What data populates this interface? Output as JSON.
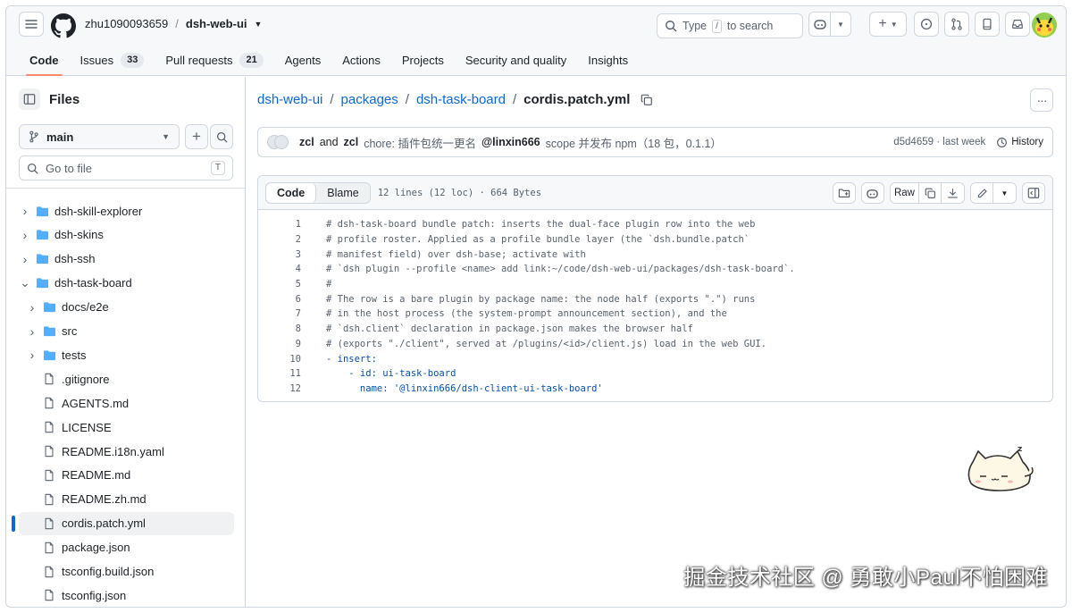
{
  "header": {
    "owner": "zhu1090093659",
    "repo": "dsh-web-ui",
    "search_prefix": "Type",
    "search_key": "/",
    "search_suffix": "to search"
  },
  "nav": {
    "tabs": [
      {
        "label": "Code",
        "count": ""
      },
      {
        "label": "Issues",
        "count": "33"
      },
      {
        "label": "Pull requests",
        "count": "21"
      },
      {
        "label": "Agents",
        "count": ""
      },
      {
        "label": "Actions",
        "count": ""
      },
      {
        "label": "Projects",
        "count": ""
      },
      {
        "label": "Security and quality",
        "count": ""
      },
      {
        "label": "Insights",
        "count": ""
      }
    ]
  },
  "sidebar": {
    "title": "Files",
    "branch": "main",
    "goto_placeholder": "Go to file",
    "goto_key": "T",
    "items": [
      {
        "label": "dsh-skill-explorer",
        "type": "folder",
        "expanded": false,
        "depth": 0
      },
      {
        "label": "dsh-skins",
        "type": "folder",
        "expanded": false,
        "depth": 0
      },
      {
        "label": "dsh-ssh",
        "type": "folder",
        "expanded": false,
        "depth": 0
      },
      {
        "label": "dsh-task-board",
        "type": "folder",
        "expanded": true,
        "depth": 0
      },
      {
        "label": "docs/e2e",
        "type": "folder",
        "expanded": false,
        "depth": 1
      },
      {
        "label": "src",
        "type": "folder",
        "expanded": false,
        "depth": 1
      },
      {
        "label": "tests",
        "type": "folder",
        "expanded": false,
        "depth": 1
      },
      {
        "label": ".gitignore",
        "type": "file",
        "depth": 1
      },
      {
        "label": "AGENTS.md",
        "type": "file",
        "depth": 1
      },
      {
        "label": "LICENSE",
        "type": "file",
        "depth": 1
      },
      {
        "label": "README.i18n.yaml",
        "type": "file",
        "depth": 1
      },
      {
        "label": "README.md",
        "type": "file",
        "depth": 1
      },
      {
        "label": "README.zh.md",
        "type": "file",
        "depth": 1
      },
      {
        "label": "cordis.patch.yml",
        "type": "file",
        "depth": 1,
        "selected": true
      },
      {
        "label": "package.json",
        "type": "file",
        "depth": 1
      },
      {
        "label": "tsconfig.build.json",
        "type": "file",
        "depth": 1
      },
      {
        "label": "tsconfig.json",
        "type": "file",
        "depth": 1
      }
    ]
  },
  "breadcrumb": {
    "parts": [
      "dsh-web-ui",
      "packages",
      "dsh-task-board"
    ],
    "current": "cordis.patch.yml"
  },
  "commit": {
    "author1": "zcl",
    "and": "and",
    "author2": "zcl",
    "message_prefix": "chore: 插件包统一更名",
    "handle": "@linxin666",
    "message_suffix": "scope 并发布 npm（18 包，0.1.1）",
    "sha": "d5d4659",
    "dot": "·",
    "when": "last week",
    "history_label": "History"
  },
  "file": {
    "view_code": "Code",
    "view_blame": "Blame",
    "info": "12 lines (12 loc) · 664 Bytes",
    "raw_label": "Raw",
    "lines": [
      "# dsh-task-board bundle patch: inserts the dual-face plugin row into the web",
      "# profile roster. Applied as a profile bundle layer (the `dsh.bundle.patch`",
      "# manifest field) over dsh-base; activate with",
      "# `dsh plugin --profile <name> add link:~/code/dsh-web-ui/packages/dsh-task-board`.",
      "#",
      "# The row is a bare plugin by package name: the node half (exports \".\") runs",
      "# in the host process (the system-prompt announcement section), and the",
      "# `dsh.client` declaration in package.json makes the browser half",
      "# (exports \"./client\", served at /plugins/<id>/client.js) load in the web GUI.",
      "- insert:",
      "    - id: ui-task-board",
      "      name: '@linxin666/dsh-client-ui-task-board'"
    ]
  },
  "watermark": "掘金技术社区 @ 勇敢小Paul不怕困难",
  "colors": {
    "accent": "#0969da",
    "tab_underline": "#fd8c73",
    "folder": "#54aeff"
  }
}
